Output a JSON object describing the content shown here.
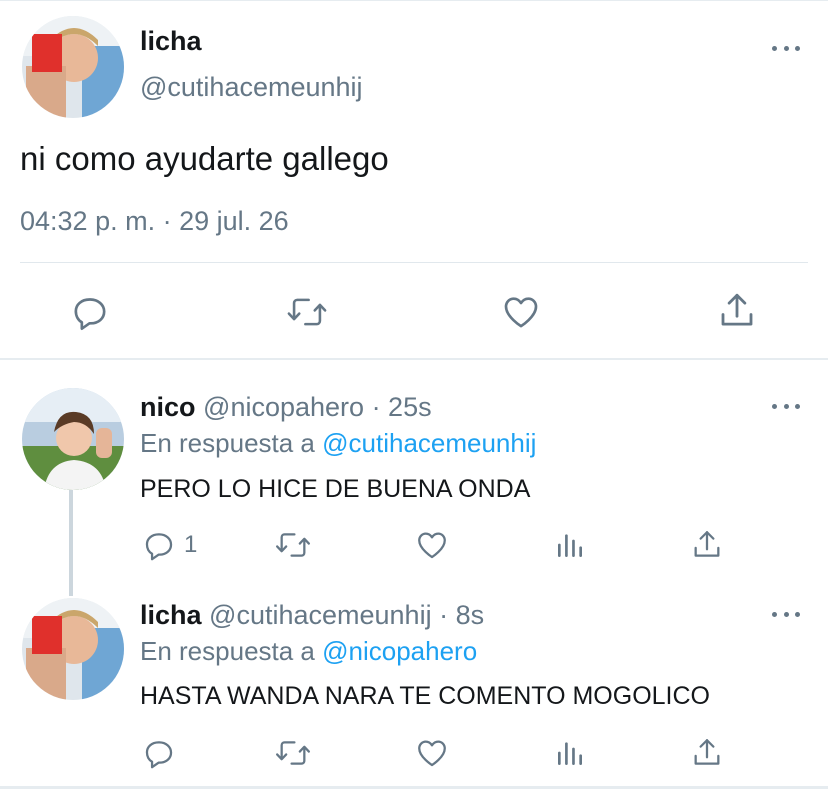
{
  "main": {
    "author": {
      "name": "licha",
      "handle": "@cutihacemeunhij"
    },
    "text": "ni como ayudarte gallego",
    "timestamp": "04:32 p. m. · 29 jul. 26",
    "actions": [
      "reply-icon",
      "retweet-icon",
      "like-icon",
      "share-icon"
    ]
  },
  "replies": [
    {
      "name": "nico",
      "handle": "@nicopahero",
      "time": "· 25s",
      "reply_prefix": "En respuesta a",
      "reply_to": "@cutihacemeunhij",
      "text": "PERO LO HICE DE BUENA ONDA",
      "reply_count": "1"
    },
    {
      "name": "licha",
      "handle": "@cutihacemeunhij",
      "time": "· 8s",
      "reply_prefix": "En respuesta a",
      "reply_to": "@nicopahero",
      "text": "HASTA WANDA NARA TE COMENTO MOGOLICO",
      "reply_count": ""
    }
  ],
  "colors": {
    "text": "#14171a",
    "secondary": "#657786",
    "link": "#1da1f2",
    "divider": "#e1e8ed"
  }
}
